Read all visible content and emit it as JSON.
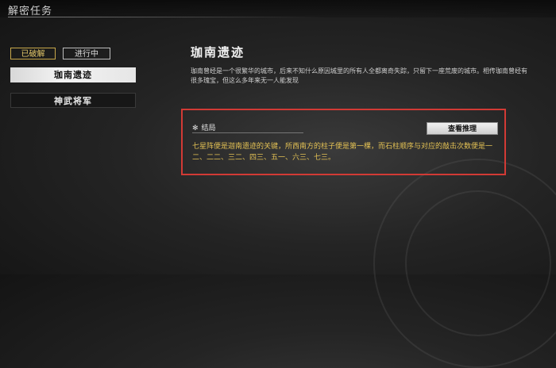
{
  "window": {
    "title": "解密任务"
  },
  "filters": {
    "solved_label": "已破解",
    "in_progress_label": "进行中"
  },
  "tasks": [
    {
      "label": "珈南遗迹"
    },
    {
      "label": "神武将军"
    }
  ],
  "detail": {
    "title": "珈南遗迹",
    "description": "珈南曾经是一个很繁华的城市，后来不知什么原因城里的所有人全都离奇失踪，只留下一座荒废的城市。相传珈南曾经有很多瑰宝，但这么多年来无一人能发现",
    "result": {
      "label": "结局",
      "button_label": "查看推理",
      "text": "七星阵便是迦南遗迹的关键，所西南方的柱子便是第一棵，而石柱顺序与对应的敲击次数便是一二、二二、三二、四三、五一、六三、七三。"
    }
  },
  "colors": {
    "accent_gold": "#e3c154",
    "highlight_red": "#d23a35"
  }
}
